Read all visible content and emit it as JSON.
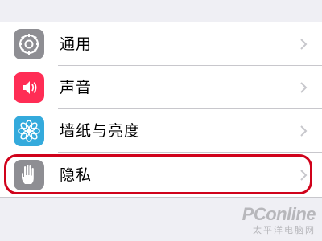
{
  "settings": {
    "items": [
      {
        "label": "通用",
        "icon": "gear-icon",
        "color": "#8e8e93"
      },
      {
        "label": "声音",
        "icon": "speaker-icon",
        "color": "#ff2d55"
      },
      {
        "label": "墙纸与亮度",
        "icon": "flower-icon",
        "color": "#34aadc"
      },
      {
        "label": "隐私",
        "icon": "hand-icon",
        "color": "#8e8e93"
      }
    ]
  },
  "annotation": {
    "color": "#d0021b"
  },
  "watermark": {
    "brand": "PConline",
    "tagline": "太平洋电脑网"
  }
}
